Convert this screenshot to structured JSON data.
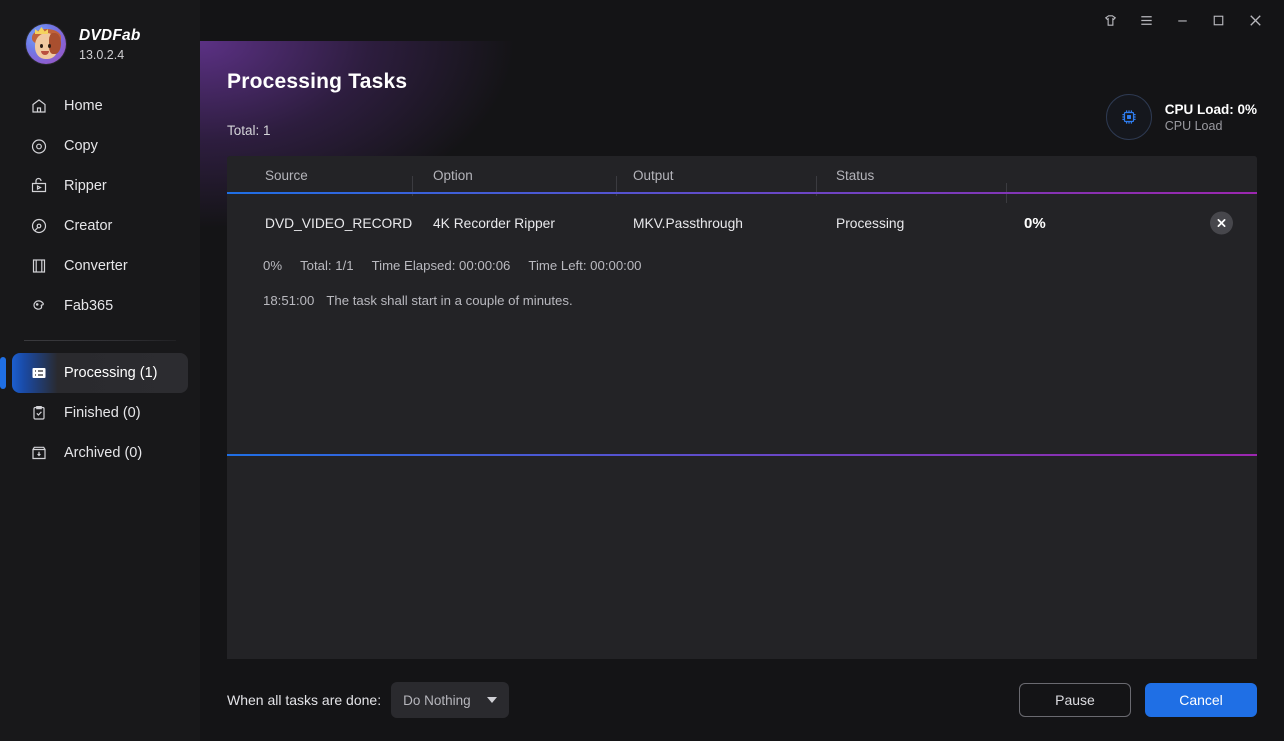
{
  "titlebar": {
    "buttons": [
      {
        "name": "theme-icon",
        "label": "Theme"
      },
      {
        "name": "menu-icon",
        "label": "Menu"
      },
      {
        "name": "minimize-icon",
        "label": "Minimize"
      },
      {
        "name": "maximize-icon",
        "label": "Maximize"
      },
      {
        "name": "close-icon",
        "label": "Close"
      }
    ]
  },
  "sidebar": {
    "brand": {
      "name": "DVDFab",
      "version": "13.0.2.4"
    },
    "items": [
      {
        "label": "Home",
        "icon": "home-icon",
        "active": false
      },
      {
        "label": "Copy",
        "icon": "copy-disc-icon",
        "active": false
      },
      {
        "label": "Ripper",
        "icon": "ripper-icon",
        "active": false
      },
      {
        "label": "Creator",
        "icon": "creator-disc-icon",
        "active": false
      },
      {
        "label": "Converter",
        "icon": "converter-icon",
        "active": false
      },
      {
        "label": "Fab365",
        "icon": "fab365-icon",
        "active": false
      }
    ],
    "queue_items": [
      {
        "label": "Processing (1)",
        "icon": "processing-list-icon",
        "active": true
      },
      {
        "label": "Finished (0)",
        "icon": "clipboard-check-icon",
        "active": false
      },
      {
        "label": "Archived (0)",
        "icon": "archive-box-icon",
        "active": false
      }
    ]
  },
  "header": {
    "title": "Processing Tasks",
    "total": "Total: 1",
    "cpu": {
      "icon": "cpu-chip-icon",
      "main": "CPU Load: 0%",
      "sub": "CPU Load"
    }
  },
  "table": {
    "columns": [
      "Source",
      "Option",
      "Output",
      "Status",
      ""
    ],
    "rows": [
      {
        "source": "DVD_VIDEO_RECORDE…",
        "option": "4K Recorder Ripper",
        "output": "MKV.Passthrough",
        "status": "Processing",
        "progress": "0%",
        "close_icon": "close-task-icon"
      }
    ],
    "detail": {
      "progress": "0%",
      "total": "Total: 1/1",
      "elapsed": "Time Elapsed: 00:00:06",
      "left": "Time Left: 00:00:00",
      "log_time": "18:51:00",
      "log_message": "The task shall start in a couple of minutes."
    }
  },
  "bottombar": {
    "when_done_label": "When all tasks are done:",
    "when_done_value": "Do Nothing",
    "pause_label": "Pause",
    "cancel_label": "Cancel"
  },
  "colors": {
    "accent_blue": "#1f6fe5",
    "accent_purple": "#9c27b0",
    "panel_bg": "#232326",
    "app_bg": "#141416",
    "sidebar_bg": "#18181a"
  }
}
